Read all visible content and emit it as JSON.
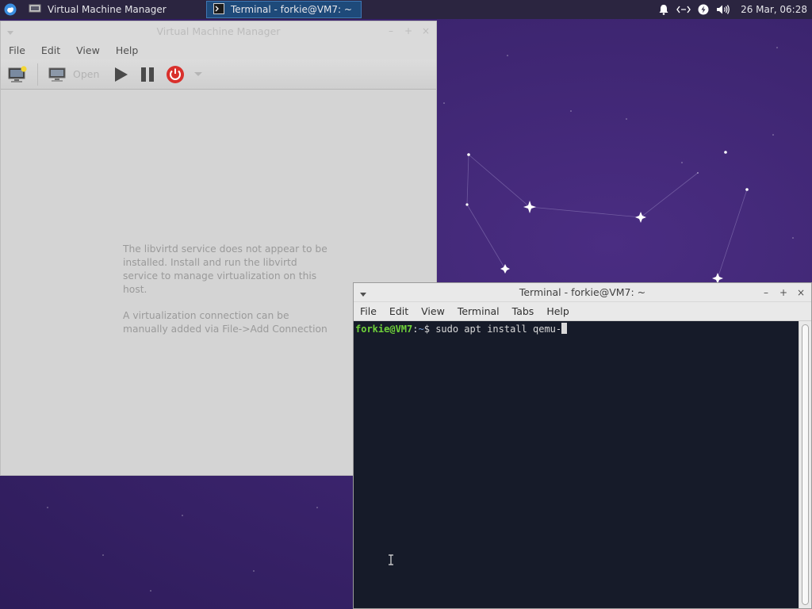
{
  "panel": {
    "tasks": [
      {
        "title": "Virtual Machine Manager",
        "icon": "virt-manager-icon",
        "active": false
      },
      {
        "title": "Terminal - forkie@VM7: ~",
        "icon": "terminal-icon",
        "active": true
      }
    ],
    "tray": [
      "bell-icon",
      "network-icon",
      "power-icon",
      "volume-icon"
    ],
    "clock": "26 Mar, 06:28"
  },
  "vmm": {
    "title": "Virtual Machine Manager",
    "menu": [
      "File",
      "Edit",
      "View",
      "Help"
    ],
    "toolbar": {
      "open_label": "Open"
    },
    "message": {
      "line1": "The libvirtd service does not appear to be installed. Install and run the libvirtd service to manage virtualization on this host.",
      "line2": "A virtualization connection can be manually added via File->Add Connection"
    }
  },
  "terminal": {
    "title": "Terminal - forkie@VM7: ~",
    "menu": [
      "File",
      "Edit",
      "View",
      "Terminal",
      "Tabs",
      "Help"
    ],
    "prompt_user": "forkie@VM7",
    "prompt_sep": ":",
    "prompt_path": "~",
    "prompt_symbol": "$",
    "command": "sudo apt install qemu-"
  },
  "colors": {
    "desktop": "#3d2570",
    "panel": "#2b2540",
    "active_task": "#1e4a7a",
    "terminal_bg": "#161b29",
    "prompt_user": "#6fd23a",
    "power_button": "#d9302c"
  }
}
